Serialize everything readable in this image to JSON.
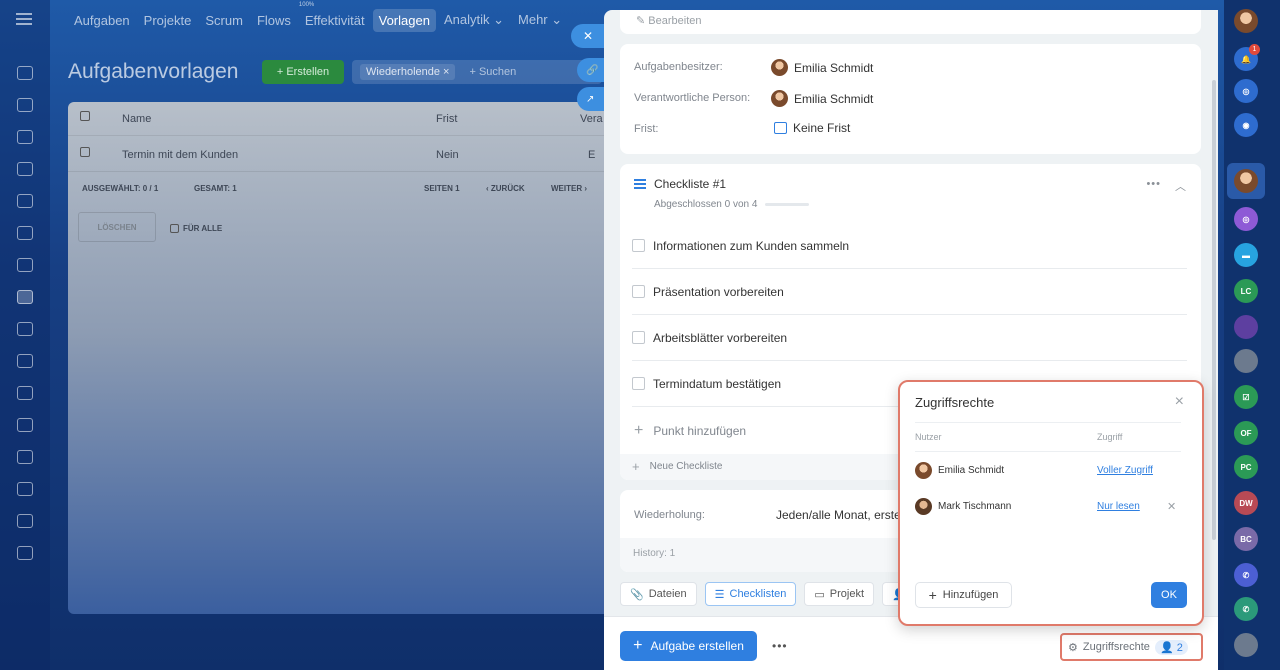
{
  "topnav": {
    "items": [
      "Aufgaben",
      "Projekte",
      "Scrum",
      "Flows",
      "Effektivität",
      "Vorlagen",
      "Analytik",
      "Mehr"
    ],
    "effectivity_badge": "100%"
  },
  "background": {
    "page_title": "Aufgabenvorlagen",
    "create_label": "+ Erstellen",
    "filter_chip": "Wiederholende",
    "search_placeholder": "+ Suchen",
    "columns": [
      "Name",
      "Frist",
      "Vera"
    ],
    "row": {
      "name": "Termin mit dem Kunden",
      "deadline": "Nein",
      "responsible": "E"
    },
    "selected": "AUSGEWÄHLT: 0 / 1",
    "total": "GESAMT: 1",
    "pages": "SEITEN  1",
    "back": "‹ ZURÜCK",
    "next": "WEITER ›",
    "delete": "LÖSCHEN",
    "for_all": "FÜR ALLE"
  },
  "panel": {
    "edit_label": "Bearbeiten",
    "owner_label": "Aufgabenbesitzer:",
    "owner": "Emilia Schmidt",
    "responsible_label": "Verantwortliche Person:",
    "responsible": "Emilia Schmidt",
    "deadline_label": "Frist:",
    "deadline": "Keine Frist",
    "checklist": {
      "title": "Checkliste #1",
      "progress_text": "Abgeschlossen 0 von 4",
      "progress": 0.0,
      "items": [
        "Informationen zum Kunden sammeln",
        "Präsentation vorbereiten",
        "Arbeitsblätter vorbereiten",
        "Termindatum bestätigen"
      ],
      "add_item": "Punkt hinzufügen",
      "new_checklist": "Neue Checkliste"
    },
    "repeat_label": "Wiederholung:",
    "repeat_value": "Jeden/alle Monat, erste",
    "history": "History: 1",
    "tabs": [
      "Dateien",
      "Checklisten",
      "Projekt"
    ],
    "create_task": "Aufgabe erstellen",
    "access_label": "Zugriffsrechte",
    "access_count": "2"
  },
  "popup": {
    "title": "Zugriffsrechte",
    "col_user": "Nutzer",
    "col_access": "Zugriff",
    "rows": [
      {
        "name": "Emilia Schmidt",
        "access": "Voller Zugriff"
      },
      {
        "name": "Mark Tischmann",
        "access": "Nur lesen"
      }
    ],
    "add_label": "Hinzufügen",
    "ok_label": "OK"
  },
  "right_rail": {
    "initials": [
      "LC",
      "OF",
      "PC",
      "DW",
      "BC"
    ],
    "notification_count": "1"
  },
  "colors": {
    "accent": "#2f7fe0",
    "highlight": "#e07a6a",
    "create_green": "#2b8a3e"
  }
}
